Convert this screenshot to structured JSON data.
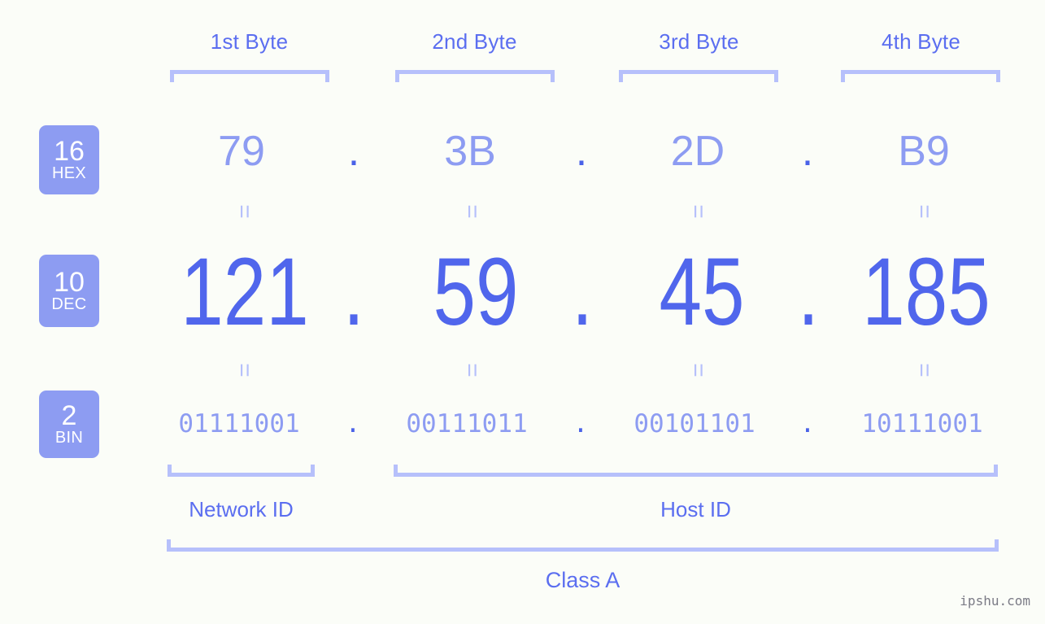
{
  "background_color": "#fbfdf8",
  "accent_color": "#5b6ef0",
  "badge_color": "#8d9cf2",
  "bracket_color": "#b6c0fb",
  "header": {
    "byte_labels": [
      {
        "label": "1st Byte"
      },
      {
        "label": "2nd Byte"
      },
      {
        "label": "3rd Byte"
      },
      {
        "label": "4th Byte"
      }
    ]
  },
  "rows": {
    "hex": {
      "badge_number": "16",
      "badge_abbr": "HEX",
      "values": [
        "79",
        "3B",
        "2D",
        "B9"
      ],
      "separator": "."
    },
    "dec": {
      "badge_number": "10",
      "badge_abbr": "DEC",
      "values": [
        "121",
        "59",
        "45",
        "185"
      ],
      "separator": "."
    },
    "bin": {
      "badge_number": "2",
      "badge_abbr": "BIN",
      "values": [
        "01111001",
        "00111011",
        "00101101",
        "10111001"
      ],
      "separator": "."
    }
  },
  "equals_marks": {
    "hex_to_dec": [
      "=",
      "=",
      "=",
      "="
    ],
    "dec_to_bin": [
      "=",
      "=",
      "=",
      "="
    ]
  },
  "footer": {
    "network_id_label": "Network ID",
    "host_id_label": "Host ID",
    "class_label": "Class A"
  },
  "watermark": "ipshu.com"
}
